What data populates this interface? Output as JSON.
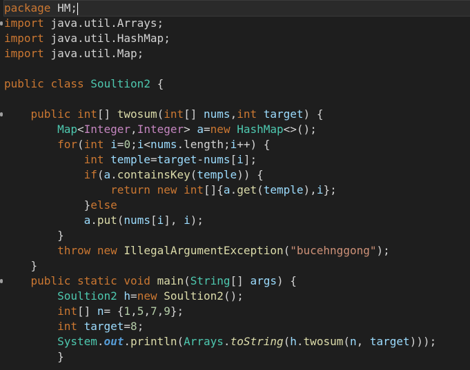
{
  "editor": {
    "language": "java",
    "colors": {
      "background": "#1e1e1e",
      "keyword": "#cc7832",
      "type": "#4ec9b0",
      "type_param": "#c586c0",
      "function": "#dcdcaa",
      "variable": "#9cdcfe",
      "number": "#b5cea8",
      "string": "#ce9178",
      "plain": "#d4d4d4"
    },
    "lines": [
      {
        "tokens": [
          {
            "t": "package",
            "c": "kw"
          },
          {
            "t": " HM;",
            "c": "pl"
          }
        ],
        "caret_after": true,
        "current": true
      },
      {
        "tokens": [
          {
            "t": "import",
            "c": "kw"
          },
          {
            "t": " java.util.Arrays;",
            "c": "pl"
          }
        ],
        "marker": true
      },
      {
        "tokens": [
          {
            "t": "import",
            "c": "kw"
          },
          {
            "t": " java.util.HashMap;",
            "c": "pl"
          }
        ]
      },
      {
        "tokens": [
          {
            "t": "import",
            "c": "kw"
          },
          {
            "t": " java.util.Map;",
            "c": "pl"
          }
        ]
      },
      {
        "tokens": []
      },
      {
        "tokens": [
          {
            "t": "public",
            "c": "kw"
          },
          {
            "t": " ",
            "c": "pl"
          },
          {
            "t": "class",
            "c": "kw"
          },
          {
            "t": " ",
            "c": "pl"
          },
          {
            "t": "Soultion2",
            "c": "ty"
          },
          {
            "t": " {",
            "c": "pl"
          }
        ]
      },
      {
        "tokens": []
      },
      {
        "tokens": [
          {
            "t": "    ",
            "c": "pl"
          },
          {
            "t": "public",
            "c": "kw"
          },
          {
            "t": " ",
            "c": "pl"
          },
          {
            "t": "int",
            "c": "kw"
          },
          {
            "t": "[] ",
            "c": "pl"
          },
          {
            "t": "twosum",
            "c": "fn"
          },
          {
            "t": "(",
            "c": "pl"
          },
          {
            "t": "int",
            "c": "kw"
          },
          {
            "t": "[] ",
            "c": "pl"
          },
          {
            "t": "nums",
            "c": "va"
          },
          {
            "t": ",",
            "c": "pl"
          },
          {
            "t": "int",
            "c": "kw"
          },
          {
            "t": " ",
            "c": "pl"
          },
          {
            "t": "target",
            "c": "va"
          },
          {
            "t": ") {",
            "c": "pl"
          }
        ],
        "marker": true
      },
      {
        "tokens": [
          {
            "t": "        ",
            "c": "pl"
          },
          {
            "t": "Map",
            "c": "ty"
          },
          {
            "t": "<",
            "c": "pl"
          },
          {
            "t": "Integer",
            "c": "tc"
          },
          {
            "t": ",",
            "c": "pl"
          },
          {
            "t": "Integer",
            "c": "tc"
          },
          {
            "t": "> ",
            "c": "pl"
          },
          {
            "t": "a",
            "c": "va"
          },
          {
            "t": "=",
            "c": "pl"
          },
          {
            "t": "new",
            "c": "kw"
          },
          {
            "t": " ",
            "c": "pl"
          },
          {
            "t": "HashMap",
            "c": "ty"
          },
          {
            "t": "<>();",
            "c": "pl"
          }
        ]
      },
      {
        "tokens": [
          {
            "t": "        ",
            "c": "pl"
          },
          {
            "t": "for",
            "c": "kw"
          },
          {
            "t": "(",
            "c": "pl"
          },
          {
            "t": "int",
            "c": "kw"
          },
          {
            "t": " ",
            "c": "pl"
          },
          {
            "t": "i",
            "c": "va"
          },
          {
            "t": "=",
            "c": "pl"
          },
          {
            "t": "0",
            "c": "nu"
          },
          {
            "t": ";",
            "c": "pl"
          },
          {
            "t": "i",
            "c": "va"
          },
          {
            "t": "<",
            "c": "pl"
          },
          {
            "t": "nums",
            "c": "va"
          },
          {
            "t": ".length;",
            "c": "pl"
          },
          {
            "t": "i",
            "c": "va"
          },
          {
            "t": "++) {",
            "c": "pl"
          }
        ]
      },
      {
        "tokens": [
          {
            "t": "            ",
            "c": "pl"
          },
          {
            "t": "int",
            "c": "kw"
          },
          {
            "t": " ",
            "c": "pl"
          },
          {
            "t": "temple",
            "c": "va"
          },
          {
            "t": "=",
            "c": "pl"
          },
          {
            "t": "target",
            "c": "va"
          },
          {
            "t": "-",
            "c": "pl"
          },
          {
            "t": "nums",
            "c": "va"
          },
          {
            "t": "[",
            "c": "pl"
          },
          {
            "t": "i",
            "c": "va"
          },
          {
            "t": "];",
            "c": "pl"
          }
        ]
      },
      {
        "tokens": [
          {
            "t": "            ",
            "c": "pl"
          },
          {
            "t": "if",
            "c": "kw"
          },
          {
            "t": "(",
            "c": "pl"
          },
          {
            "t": "a",
            "c": "va"
          },
          {
            "t": ".",
            "c": "pl"
          },
          {
            "t": "containsKey",
            "c": "fn"
          },
          {
            "t": "(",
            "c": "pl"
          },
          {
            "t": "temple",
            "c": "va"
          },
          {
            "t": ")) {",
            "c": "pl"
          }
        ]
      },
      {
        "tokens": [
          {
            "t": "                ",
            "c": "pl"
          },
          {
            "t": "return",
            "c": "kw"
          },
          {
            "t": " ",
            "c": "pl"
          },
          {
            "t": "new",
            "c": "kw"
          },
          {
            "t": " ",
            "c": "pl"
          },
          {
            "t": "int",
            "c": "kw"
          },
          {
            "t": "[]{",
            "c": "pl"
          },
          {
            "t": "a",
            "c": "va"
          },
          {
            "t": ".",
            "c": "pl"
          },
          {
            "t": "get",
            "c": "fn"
          },
          {
            "t": "(",
            "c": "pl"
          },
          {
            "t": "temple",
            "c": "va"
          },
          {
            "t": "),",
            "c": "pl"
          },
          {
            "t": "i",
            "c": "va"
          },
          {
            "t": "};",
            "c": "pl"
          }
        ]
      },
      {
        "tokens": [
          {
            "t": "            }",
            "c": "pl"
          },
          {
            "t": "else",
            "c": "kw"
          }
        ]
      },
      {
        "tokens": [
          {
            "t": "            ",
            "c": "pl"
          },
          {
            "t": "a",
            "c": "va"
          },
          {
            "t": ".",
            "c": "pl"
          },
          {
            "t": "put",
            "c": "fn"
          },
          {
            "t": "(",
            "c": "pl"
          },
          {
            "t": "nums",
            "c": "va"
          },
          {
            "t": "[",
            "c": "pl"
          },
          {
            "t": "i",
            "c": "va"
          },
          {
            "t": "], ",
            "c": "pl"
          },
          {
            "t": "i",
            "c": "va"
          },
          {
            "t": ");",
            "c": "pl"
          }
        ]
      },
      {
        "tokens": [
          {
            "t": "        }",
            "c": "pl"
          }
        ]
      },
      {
        "tokens": [
          {
            "t": "        ",
            "c": "pl"
          },
          {
            "t": "throw",
            "c": "kw"
          },
          {
            "t": " ",
            "c": "pl"
          },
          {
            "t": "new",
            "c": "kw"
          },
          {
            "t": " ",
            "c": "pl"
          },
          {
            "t": "IllegalArgumentException",
            "c": "fn"
          },
          {
            "t": "(",
            "c": "pl"
          },
          {
            "t": "\"bucehnggong\"",
            "c": "st"
          },
          {
            "t": ");",
            "c": "pl"
          }
        ]
      },
      {
        "tokens": [
          {
            "t": "    }",
            "c": "pl"
          }
        ]
      },
      {
        "tokens": [
          {
            "t": "    ",
            "c": "pl"
          },
          {
            "t": "public",
            "c": "kw"
          },
          {
            "t": " ",
            "c": "pl"
          },
          {
            "t": "static",
            "c": "kw"
          },
          {
            "t": " ",
            "c": "pl"
          },
          {
            "t": "void",
            "c": "kw"
          },
          {
            "t": " ",
            "c": "pl"
          },
          {
            "t": "main",
            "c": "fn"
          },
          {
            "t": "(",
            "c": "pl"
          },
          {
            "t": "String",
            "c": "ty"
          },
          {
            "t": "[] ",
            "c": "pl"
          },
          {
            "t": "args",
            "c": "va"
          },
          {
            "t": ") {",
            "c": "pl"
          }
        ],
        "marker": true
      },
      {
        "tokens": [
          {
            "t": "        ",
            "c": "pl"
          },
          {
            "t": "Soultion2",
            "c": "ty"
          },
          {
            "t": " ",
            "c": "pl"
          },
          {
            "t": "h",
            "c": "va"
          },
          {
            "t": "=",
            "c": "pl"
          },
          {
            "t": "new",
            "c": "kw"
          },
          {
            "t": " ",
            "c": "pl"
          },
          {
            "t": "Soultion2",
            "c": "fn"
          },
          {
            "t": "();",
            "c": "pl"
          }
        ]
      },
      {
        "tokens": [
          {
            "t": "        ",
            "c": "pl"
          },
          {
            "t": "int",
            "c": "kw"
          },
          {
            "t": "[] ",
            "c": "pl"
          },
          {
            "t": "n",
            "c": "va"
          },
          {
            "t": "= {",
            "c": "pl"
          },
          {
            "t": "1",
            "c": "nu"
          },
          {
            "t": ",",
            "c": "pl"
          },
          {
            "t": "5",
            "c": "nu"
          },
          {
            "t": ",",
            "c": "pl"
          },
          {
            "t": "7",
            "c": "nu"
          },
          {
            "t": ",",
            "c": "pl"
          },
          {
            "t": "9",
            "c": "nu"
          },
          {
            "t": "};",
            "c": "pl"
          }
        ]
      },
      {
        "tokens": [
          {
            "t": "        ",
            "c": "pl"
          },
          {
            "t": "int",
            "c": "kw"
          },
          {
            "t": " ",
            "c": "pl"
          },
          {
            "t": "target",
            "c": "va"
          },
          {
            "t": "=",
            "c": "pl"
          },
          {
            "t": "8",
            "c": "nu"
          },
          {
            "t": ";",
            "c": "pl"
          }
        ]
      },
      {
        "tokens": [
          {
            "t": "        ",
            "c": "pl"
          },
          {
            "t": "System",
            "c": "ty"
          },
          {
            "t": ".",
            "c": "pl"
          },
          {
            "t": "out",
            "c": "sfield"
          },
          {
            "t": ".",
            "c": "pl"
          },
          {
            "t": "println",
            "c": "fn"
          },
          {
            "t": "(",
            "c": "pl"
          },
          {
            "t": "Arrays",
            "c": "ty"
          },
          {
            "t": ".",
            "c": "pl"
          },
          {
            "t": "toString",
            "c": "smeth"
          },
          {
            "t": "(",
            "c": "pl"
          },
          {
            "t": "h",
            "c": "va"
          },
          {
            "t": ".",
            "c": "pl"
          },
          {
            "t": "twosum",
            "c": "fn"
          },
          {
            "t": "(",
            "c": "pl"
          },
          {
            "t": "n",
            "c": "va"
          },
          {
            "t": ", ",
            "c": "pl"
          },
          {
            "t": "target",
            "c": "va"
          },
          {
            "t": ")));",
            "c": "pl"
          }
        ]
      },
      {
        "tokens": [
          {
            "t": "        }",
            "c": "pl"
          }
        ]
      }
    ]
  }
}
